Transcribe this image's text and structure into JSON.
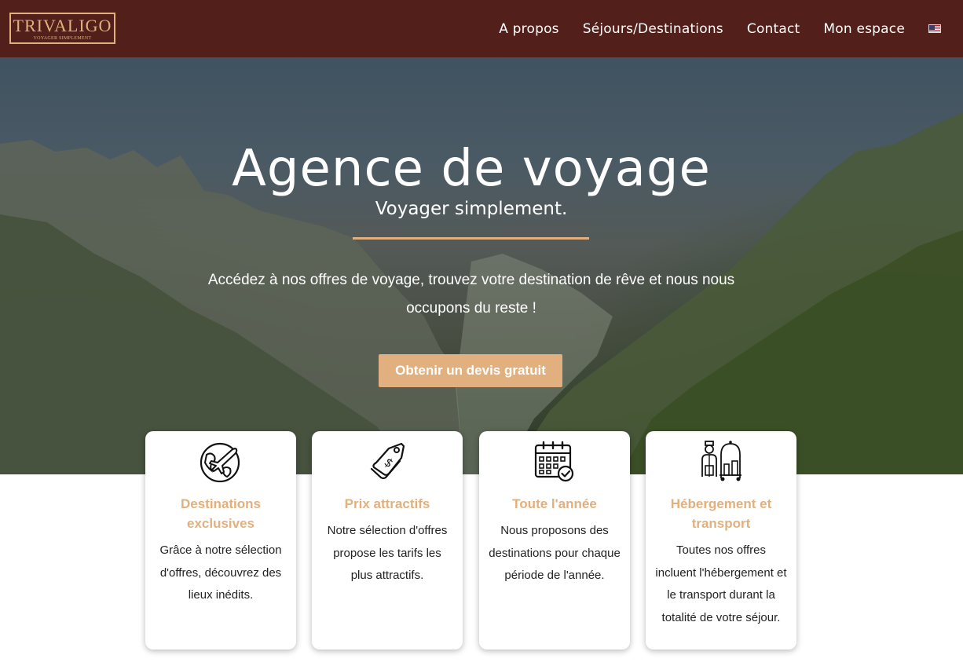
{
  "brand": {
    "name": "TRIVALIGO",
    "tagline": "VOYAGER SIMPLEMENT"
  },
  "nav": {
    "items": [
      {
        "label": "A propos"
      },
      {
        "label": "Séjours/Destinations"
      },
      {
        "label": "Contact"
      },
      {
        "label": "Mon espace"
      }
    ],
    "language_icon": "us-flag-icon"
  },
  "hero": {
    "title": "Agence de voyage",
    "subtitle": "Voyager simplement.",
    "text": "Accédez à nos offres de voyage, trouvez votre destination de rêve et nous nous occupons du reste !",
    "cta_label": "Obtenir un devis gratuit"
  },
  "features": [
    {
      "icon": "globe-plane-icon",
      "title": "Destinations exclusives",
      "text": "Grâce à notre sélection d'offres, découvrez des lieux inédits."
    },
    {
      "icon": "price-tag-icon",
      "title": "Prix attractifs",
      "text": "Notre sélection d'offres propose les tarifs les plus attractifs."
    },
    {
      "icon": "calendar-check-icon",
      "title": "Toute l'année",
      "text": "Nous proposons des destinations pour chaque période de l'année."
    },
    {
      "icon": "bellboy-luggage-icon",
      "title": "Hébergement et transport",
      "text": "Toutes nos offres incluent l'hébergement et le transport durant la totalité de votre séjour."
    }
  ],
  "colors": {
    "nav_background": "#521f1a",
    "accent": "#e2b07e",
    "text_dark": "#222222"
  }
}
